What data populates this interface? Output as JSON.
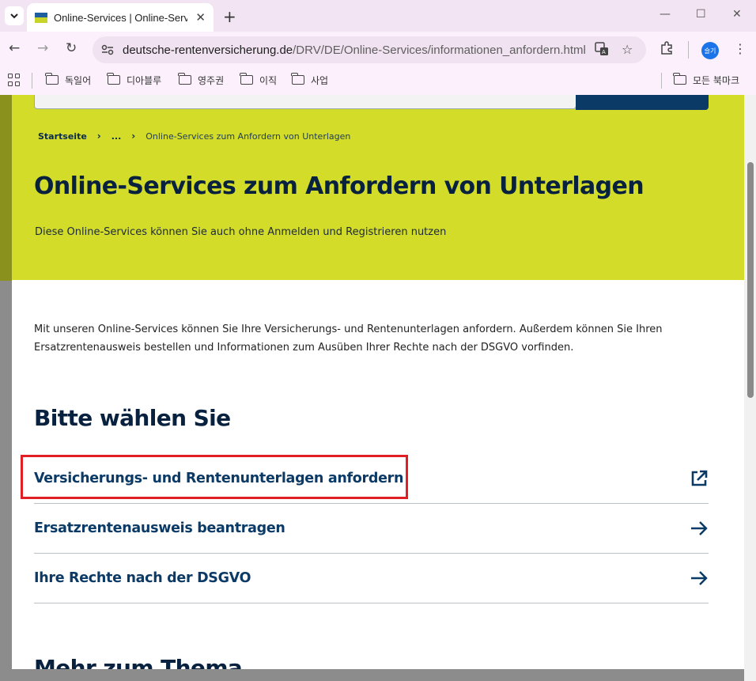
{
  "browser": {
    "tab_title": "Online-Services | Online-Services",
    "url_host": "deutsche-rentenversicherung.de",
    "url_path": "/DRV/DE/Online-Services/informationen_anfordern.html",
    "profile_label": "슬기",
    "bookmarks": [
      "독일어",
      "디아블루",
      "영주권",
      "이직",
      "사업"
    ],
    "all_bookmarks_label": "모든 북마크"
  },
  "page": {
    "breadcrumb": {
      "home": "Startseite",
      "ellipsis": "...",
      "current": "Online-Services zum Anfordern von Unterlagen"
    },
    "title": "Online-Services zum Anfordern von Unterlagen",
    "subtitle": "Diese Online-Services können Sie auch ohne Anmelden und Registrieren nutzen",
    "intro": "Mit unseren Online-Services können Sie Ihre Versicherungs- und Rentenunterlagen anfordern. Außerdem können Sie Ihren Ersatzrentenausweis bestellen und Informationen zum Ausüben Ihrer Rechte nach der DSGVO vorfinden.",
    "choose_heading": "Bitte wählen Sie",
    "links": [
      {
        "label": "Versicherungs- und Rentenunterlagen anfordern",
        "icon": "external-link-icon"
      },
      {
        "label": "Ersatzrentenausweis beantragen",
        "icon": "arrow-right-icon"
      },
      {
        "label": "Ihre Rechte nach der DSGVO",
        "icon": "arrow-right-icon"
      }
    ],
    "more_heading": "Mehr zum Thema"
  },
  "colors": {
    "hero_bg": "#d4dc2a",
    "heading": "#07213f",
    "link": "#0b3a66",
    "highlight": "#e01e24"
  }
}
